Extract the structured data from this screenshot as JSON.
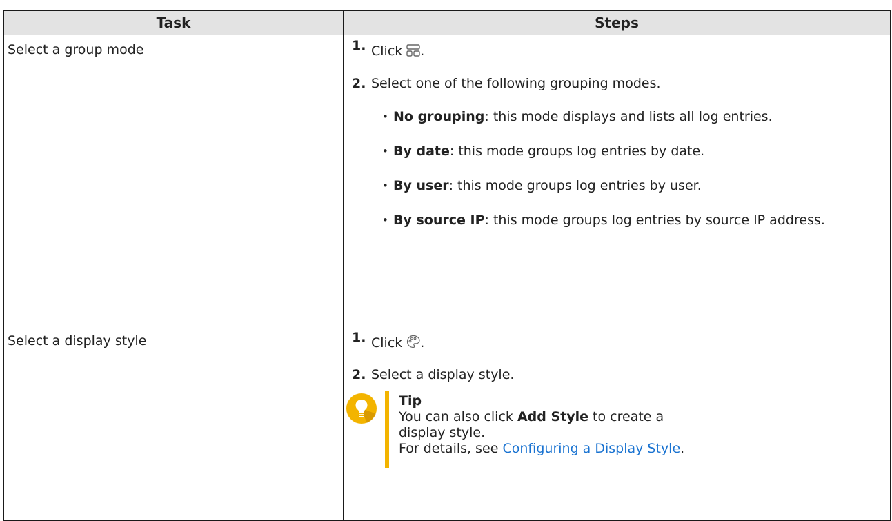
{
  "table": {
    "headers": {
      "task": "Task",
      "steps": "Steps"
    },
    "row1": {
      "task": "Select a group mode",
      "step1": {
        "num": "1.",
        "text": "Click",
        "after": ".",
        "icon": "grid-group-icon"
      },
      "step2": {
        "num": "2.",
        "text": "Select one of the following grouping modes."
      },
      "bullets": [
        {
          "term": "No grouping",
          "desc": ": this mode displays and lists all log entries."
        },
        {
          "term": "By date",
          "desc": ": this mode groups log entries by date."
        },
        {
          "term": "By user",
          "desc": ": this mode groups log entries by user."
        },
        {
          "term": "By source IP",
          "desc": ": this mode groups log entries by source IP address."
        }
      ]
    },
    "row2": {
      "task": "Select a display style",
      "step1": {
        "num": "1.",
        "text": "Click",
        "after": ".",
        "icon": "palette-icon"
      },
      "step2": {
        "num": "2.",
        "text": "Select a display style."
      },
      "tip": {
        "icon": "lightbulb-icon",
        "title": "Tip",
        "line1_pre": "You can also click ",
        "line1_bold": "Add Style",
        "line1_post": " to create a display style.",
        "line2_pre": "For details, see ",
        "line2_link": "Configuring a Display Style",
        "line2_post": "."
      }
    }
  },
  "colors": {
    "header_bg": "#e3e3e3",
    "tip_accent": "#f3b400",
    "link": "#1a73d1"
  }
}
